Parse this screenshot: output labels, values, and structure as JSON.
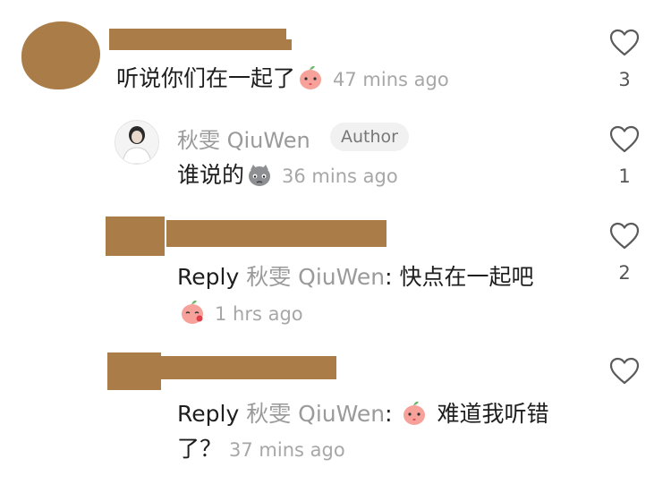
{
  "comments": [
    {
      "text": "听说你们在一起了",
      "time": "47 mins ago",
      "likes": "3",
      "emoji": "peach-kiss-emoji"
    },
    {
      "author": "秋雯 QiuWen",
      "badge": "Author",
      "text": "谁说的",
      "time": "36 mins ago",
      "likes": "1",
      "emoji": "grey-cat-sad-emoji"
    },
    {
      "reply_prefix": "Reply",
      "reply_to": "秋雯 QiuWen",
      "text": "快点在一起吧",
      "time": "1 hrs ago",
      "likes": "2",
      "emoji": "peach-blush-emoji"
    },
    {
      "reply_prefix": "Reply",
      "reply_to": "秋雯 QiuWen",
      "text_line1": "难道我听错",
      "text_line2": "了？",
      "time": "37 mins ago",
      "likes": "",
      "emoji": "peach-kiss-emoji"
    }
  ],
  "colors": {
    "redaction": "#a97c48",
    "muted_text": "#9a9a9a",
    "heart_stroke": "#5a5a5a"
  }
}
